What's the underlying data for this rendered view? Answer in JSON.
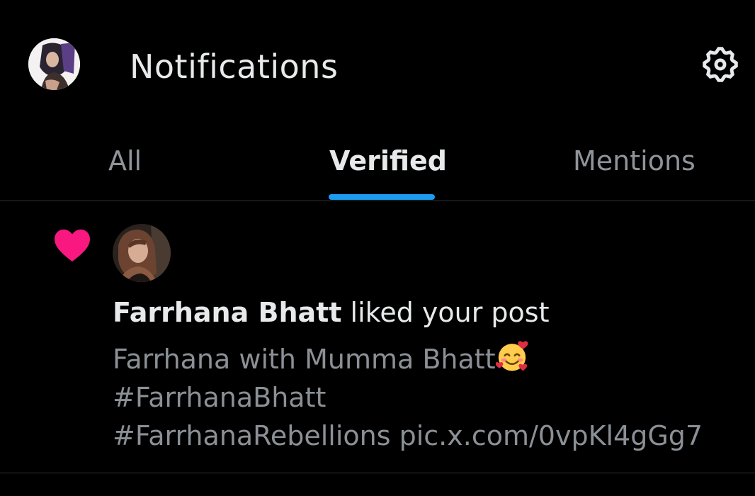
{
  "header": {
    "title": "Notifications",
    "avatar_icon": "profile-avatar",
    "settings_icon": "gear-icon"
  },
  "tabs": [
    {
      "label": "All",
      "active": false
    },
    {
      "label": "Verified",
      "active": true
    },
    {
      "label": "Mentions",
      "active": false
    }
  ],
  "colors": {
    "background": "#000000",
    "accent": "#1d9bf0",
    "like": "#f91880",
    "text_primary": "#e7e9ea",
    "text_secondary": "#8b9096"
  },
  "notification": {
    "type_icon": "heart-icon",
    "user_name": "Farrhana Bhatt",
    "action": " liked your post",
    "post_lines": [
      "Farrhana with Mumma Bhatt",
      "#FarrhanaBhatt",
      "#FarrhanaRebellions pic.x.com/0vpKl4gGg7"
    ],
    "emoji": "smiling-face-with-hearts"
  }
}
